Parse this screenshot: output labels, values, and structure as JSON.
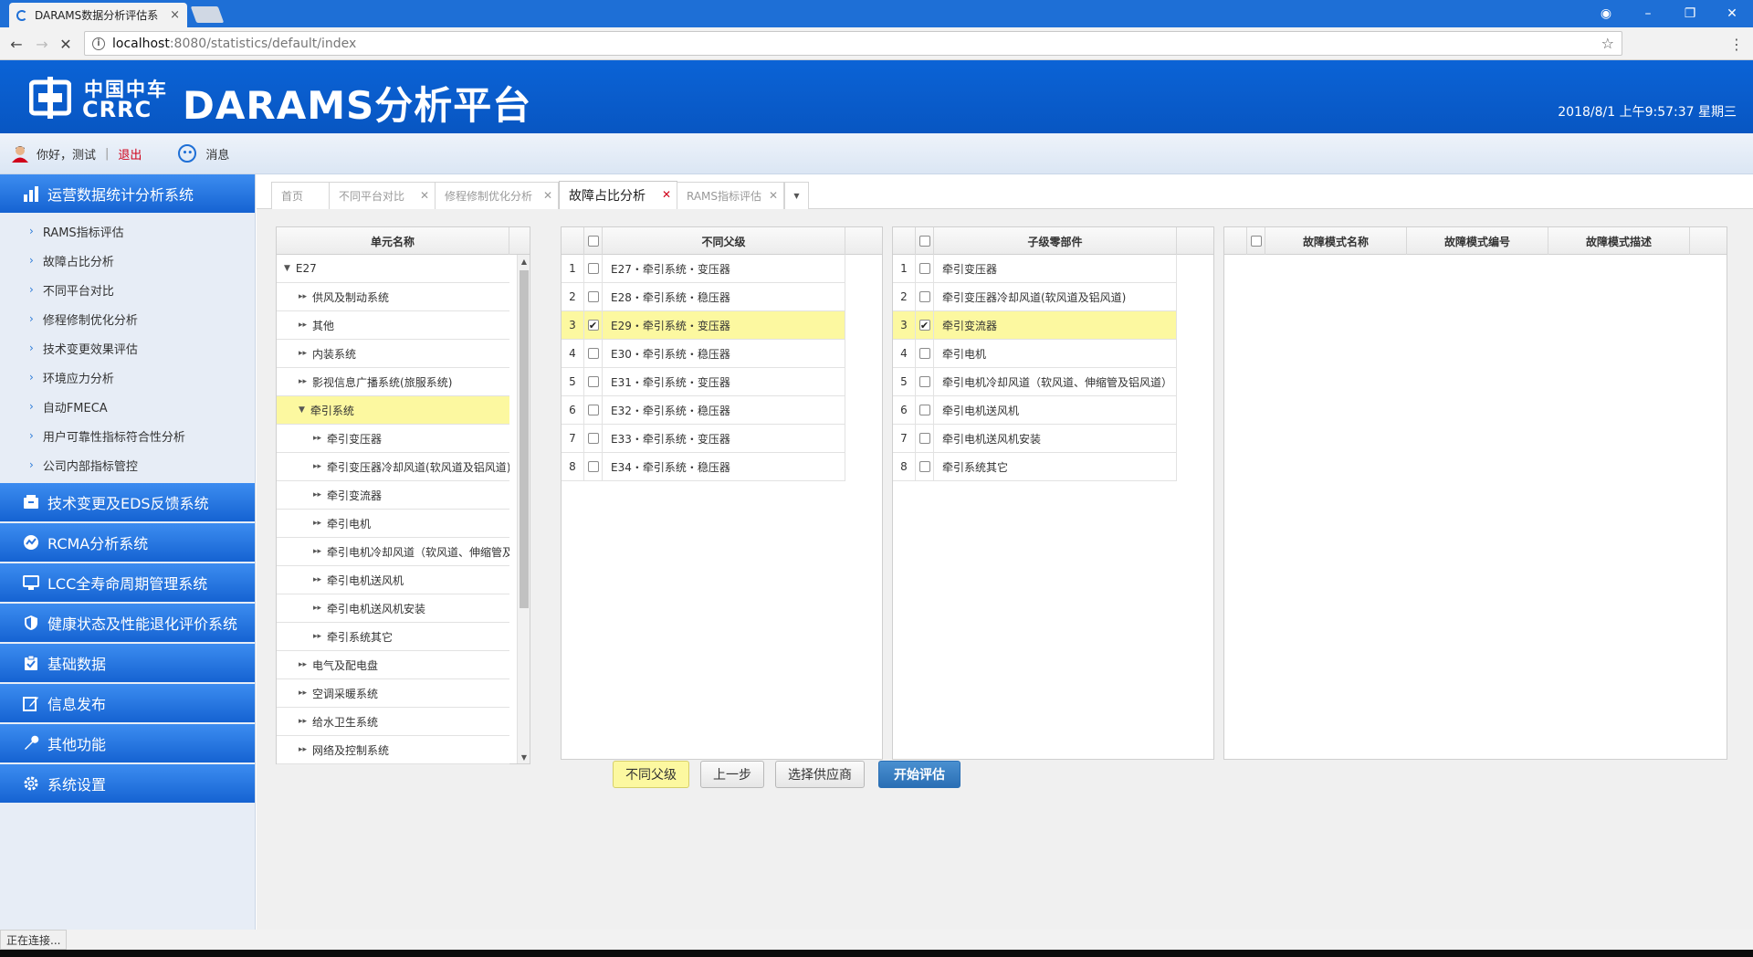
{
  "browser": {
    "tab_title": "DARAMS数据分析评估系",
    "tab_close": "×",
    "url_host": "localhost",
    "url_path": ":8080/statistics/default/index"
  },
  "header": {
    "logo_cn": "中国中车",
    "logo_en": "CRRC",
    "title": "DARAMS分析平台",
    "datetime": "2018/8/1 上午9:57:37 星期三"
  },
  "userbar": {
    "greeting": "你好，测试",
    "separator": "|",
    "logout": "退出",
    "messages": "消息"
  },
  "sidebar": {
    "systems": [
      {
        "label": "运营数据统计分析系统",
        "icon": "bar-chart-icon"
      },
      {
        "label": "技术变更及EDS反馈系统",
        "icon": "inbox-icon"
      },
      {
        "label": "RCMA分析系统",
        "icon": "gauge-icon"
      },
      {
        "label": "LCC全寿命周期管理系统",
        "icon": "screen-icon"
      },
      {
        "label": "健康状态及性能退化评价系统",
        "icon": "shield-icon"
      },
      {
        "label": "基础数据",
        "icon": "clipboard-icon"
      },
      {
        "label": "信息发布",
        "icon": "edit-icon"
      },
      {
        "label": "其他功能",
        "icon": "wrench-icon"
      },
      {
        "label": "系统设置",
        "icon": "gear-icon"
      }
    ],
    "submenu": [
      "RAMS指标评估",
      "故障占比分析",
      "不同平台对比",
      "修程修制优化分析",
      "技术变更效果评估",
      "环境应力分析",
      "自动FMECA",
      "用户可靠性指标符合性分析",
      "公司内部指标管控"
    ]
  },
  "page_tabs": [
    {
      "label": "首页",
      "closable": false
    },
    {
      "label": "不同平台对比",
      "closable": true
    },
    {
      "label": "修程修制优化分析",
      "closable": true
    },
    {
      "label": "故障占比分析",
      "closable": true,
      "active": true
    },
    {
      "label": "RAMS指标评估",
      "closable": true
    }
  ],
  "tree": {
    "header": "单元名称",
    "rows": [
      {
        "label": "E27",
        "level": 0,
        "expanded": true
      },
      {
        "label": "供风及制动系统",
        "level": 1
      },
      {
        "label": "其他",
        "level": 1
      },
      {
        "label": "内装系统",
        "level": 1
      },
      {
        "label": "影视信息广播系统(旅服系统)",
        "level": 1
      },
      {
        "label": "牵引系统",
        "level": 1,
        "expanded": true,
        "selected": true
      },
      {
        "label": "牵引变压器",
        "level": 2
      },
      {
        "label": "牵引变压器冷却风道(软风道及铝风道)",
        "level": 2
      },
      {
        "label": "牵引变流器",
        "level": 2
      },
      {
        "label": "牵引电机",
        "level": 2
      },
      {
        "label": "牵引电机冷却风道（软风道、伸缩管及铝风道）",
        "level": 2
      },
      {
        "label": "牵引电机送风机",
        "level": 2
      },
      {
        "label": "牵引电机送风机安装",
        "level": 2
      },
      {
        "label": "牵引系统其它",
        "level": 2
      },
      {
        "label": "电气及配电盘",
        "level": 1
      },
      {
        "label": "空调采暖系统",
        "level": 1
      },
      {
        "label": "给水卫生系统",
        "level": 1
      },
      {
        "label": "网络及控制系统",
        "level": 1
      }
    ]
  },
  "parents": {
    "header": "不同父级",
    "rows": [
      {
        "num": "1",
        "label": "E27・牵引系统・变压器",
        "checked": false
      },
      {
        "num": "2",
        "label": "E28・牵引系统・稳压器",
        "checked": false
      },
      {
        "num": "3",
        "label": "E29・牵引系统・变压器",
        "checked": true
      },
      {
        "num": "4",
        "label": "E30・牵引系统・稳压器",
        "checked": false
      },
      {
        "num": "5",
        "label": "E31・牵引系统・变压器",
        "checked": false
      },
      {
        "num": "6",
        "label": "E32・牵引系统・稳压器",
        "checked": false
      },
      {
        "num": "7",
        "label": "E33・牵引系统・变压器",
        "checked": false
      },
      {
        "num": "8",
        "label": "E34・牵引系统・稳压器",
        "checked": false
      }
    ]
  },
  "children": {
    "header": "子级零部件",
    "rows": [
      {
        "num": "1",
        "label": "牵引变压器",
        "checked": false
      },
      {
        "num": "2",
        "label": "牵引变压器冷却风道(软风道及铝风道)",
        "checked": false
      },
      {
        "num": "3",
        "label": "牵引变流器",
        "checked": true
      },
      {
        "num": "4",
        "label": "牵引电机",
        "checked": false
      },
      {
        "num": "5",
        "label": "牵引电机冷却风道（软风道、伸缩管及铝风道）",
        "checked": false
      },
      {
        "num": "6",
        "label": "牵引电机送风机",
        "checked": false
      },
      {
        "num": "7",
        "label": "牵引电机送风机安装",
        "checked": false
      },
      {
        "num": "8",
        "label": "牵引系统其它",
        "checked": false
      }
    ]
  },
  "fault_modes": {
    "headers": [
      "故障模式名称",
      "故障模式编号",
      "故障模式描述"
    ]
  },
  "buttons": {
    "diff_parent": "不同父级",
    "prev": "上一步",
    "choose_supplier": "选择供应商",
    "start": "开始评估"
  },
  "status": {
    "text": "正在连接..."
  },
  "colors": {
    "brand_blue": "#0b63d6",
    "selection_yellow": "#fcf8a0",
    "primary_button": "#2a6fb5"
  }
}
